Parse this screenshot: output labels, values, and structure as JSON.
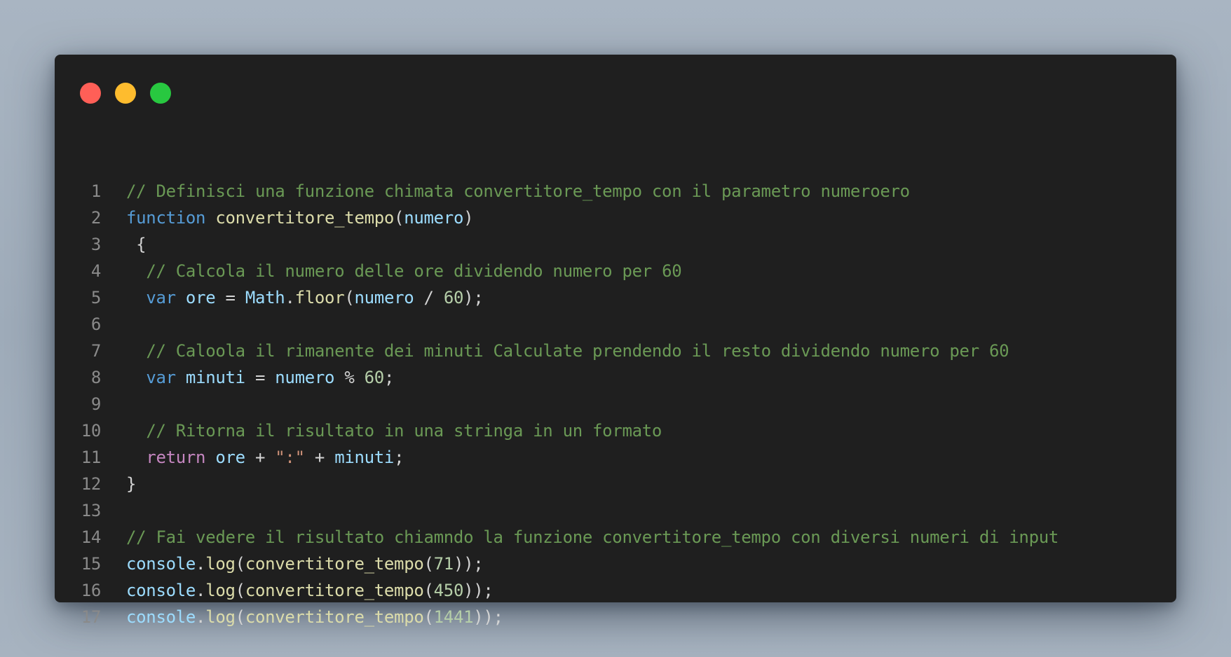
{
  "window": {
    "controls": {
      "close_color": "#ff5f57",
      "minimize_color": "#febc2e",
      "maximize_color": "#28c840"
    }
  },
  "colors": {
    "background": "#1f1f1f",
    "comment": "#6a9955",
    "keyword": "#569cd6",
    "control": "#c586c0",
    "function": "#dcdcaa",
    "variable": "#9cdcfe",
    "number": "#b5cea8",
    "string": "#ce9178",
    "plain": "#d4d4d4"
  },
  "code": {
    "lines": [
      {
        "n": "1",
        "tokens": [
          {
            "t": "comment",
            "v": "// Definisci una funzione chimata convertitore_tempo con il parametro numeroero"
          }
        ]
      },
      {
        "n": "2",
        "tokens": [
          {
            "t": "keyword",
            "v": "function"
          },
          {
            "t": "punct",
            "v": " "
          },
          {
            "t": "func",
            "v": "convertitore_tempo"
          },
          {
            "t": "punct",
            "v": "("
          },
          {
            "t": "var",
            "v": "numero"
          },
          {
            "t": "punct",
            "v": ")"
          }
        ]
      },
      {
        "n": "3",
        "tokens": [
          {
            "t": "punct",
            "v": " {"
          }
        ]
      },
      {
        "n": "4",
        "tokens": [
          {
            "t": "punct",
            "v": "  "
          },
          {
            "t": "comment",
            "v": "// Calcola il numero delle ore dividendo numero per 60"
          }
        ]
      },
      {
        "n": "5",
        "tokens": [
          {
            "t": "punct",
            "v": "  "
          },
          {
            "t": "keyword",
            "v": "var"
          },
          {
            "t": "punct",
            "v": " "
          },
          {
            "t": "var",
            "v": "ore"
          },
          {
            "t": "punct",
            "v": " = "
          },
          {
            "t": "var",
            "v": "Math"
          },
          {
            "t": "punct",
            "v": "."
          },
          {
            "t": "func",
            "v": "floor"
          },
          {
            "t": "punct",
            "v": "("
          },
          {
            "t": "var",
            "v": "numero"
          },
          {
            "t": "punct",
            "v": " / "
          },
          {
            "t": "number",
            "v": "60"
          },
          {
            "t": "punct",
            "v": ");"
          }
        ]
      },
      {
        "n": "6",
        "tokens": []
      },
      {
        "n": "7",
        "tokens": [
          {
            "t": "punct",
            "v": "  "
          },
          {
            "t": "comment",
            "v": "// Caloola il rimanente dei minuti Calculate prendendo il resto dividendo numero per 60"
          }
        ]
      },
      {
        "n": "8",
        "tokens": [
          {
            "t": "punct",
            "v": "  "
          },
          {
            "t": "keyword",
            "v": "var"
          },
          {
            "t": "punct",
            "v": " "
          },
          {
            "t": "var",
            "v": "minuti"
          },
          {
            "t": "punct",
            "v": " = "
          },
          {
            "t": "var",
            "v": "numero"
          },
          {
            "t": "punct",
            "v": " % "
          },
          {
            "t": "number",
            "v": "60"
          },
          {
            "t": "punct",
            "v": ";"
          }
        ]
      },
      {
        "n": "9",
        "tokens": []
      },
      {
        "n": "10",
        "tokens": [
          {
            "t": "punct",
            "v": "  "
          },
          {
            "t": "comment",
            "v": "// Ritorna il risultato in una stringa in un formato"
          }
        ]
      },
      {
        "n": "11",
        "tokens": [
          {
            "t": "punct",
            "v": "  "
          },
          {
            "t": "control",
            "v": "return"
          },
          {
            "t": "punct",
            "v": " "
          },
          {
            "t": "var",
            "v": "ore"
          },
          {
            "t": "punct",
            "v": " + "
          },
          {
            "t": "string",
            "v": "\":\""
          },
          {
            "t": "punct",
            "v": " + "
          },
          {
            "t": "var",
            "v": "minuti"
          },
          {
            "t": "punct",
            "v": ";"
          }
        ]
      },
      {
        "n": "12",
        "tokens": [
          {
            "t": "punct",
            "v": "}"
          }
        ]
      },
      {
        "n": "13",
        "tokens": []
      },
      {
        "n": "14",
        "tokens": [
          {
            "t": "comment",
            "v": "// Fai vedere il risultato chiamndo la funzione convertitore_tempo con diversi numeri di input"
          }
        ]
      },
      {
        "n": "15",
        "tokens": [
          {
            "t": "var",
            "v": "console"
          },
          {
            "t": "punct",
            "v": "."
          },
          {
            "t": "func",
            "v": "log"
          },
          {
            "t": "punct",
            "v": "("
          },
          {
            "t": "func",
            "v": "convertitore_tempo"
          },
          {
            "t": "punct",
            "v": "("
          },
          {
            "t": "number",
            "v": "71"
          },
          {
            "t": "punct",
            "v": "));"
          }
        ]
      },
      {
        "n": "16",
        "tokens": [
          {
            "t": "var",
            "v": "console"
          },
          {
            "t": "punct",
            "v": "."
          },
          {
            "t": "func",
            "v": "log"
          },
          {
            "t": "punct",
            "v": "("
          },
          {
            "t": "func",
            "v": "convertitore_tempo"
          },
          {
            "t": "punct",
            "v": "("
          },
          {
            "t": "number",
            "v": "450"
          },
          {
            "t": "punct",
            "v": "));"
          }
        ]
      },
      {
        "n": "17",
        "tokens": [
          {
            "t": "var",
            "v": "console"
          },
          {
            "t": "punct",
            "v": "."
          },
          {
            "t": "func",
            "v": "log"
          },
          {
            "t": "punct",
            "v": "("
          },
          {
            "t": "func",
            "v": "convertitore_tempo"
          },
          {
            "t": "punct",
            "v": "("
          },
          {
            "t": "number",
            "v": "1441"
          },
          {
            "t": "punct",
            "v": "));"
          }
        ]
      }
    ]
  }
}
